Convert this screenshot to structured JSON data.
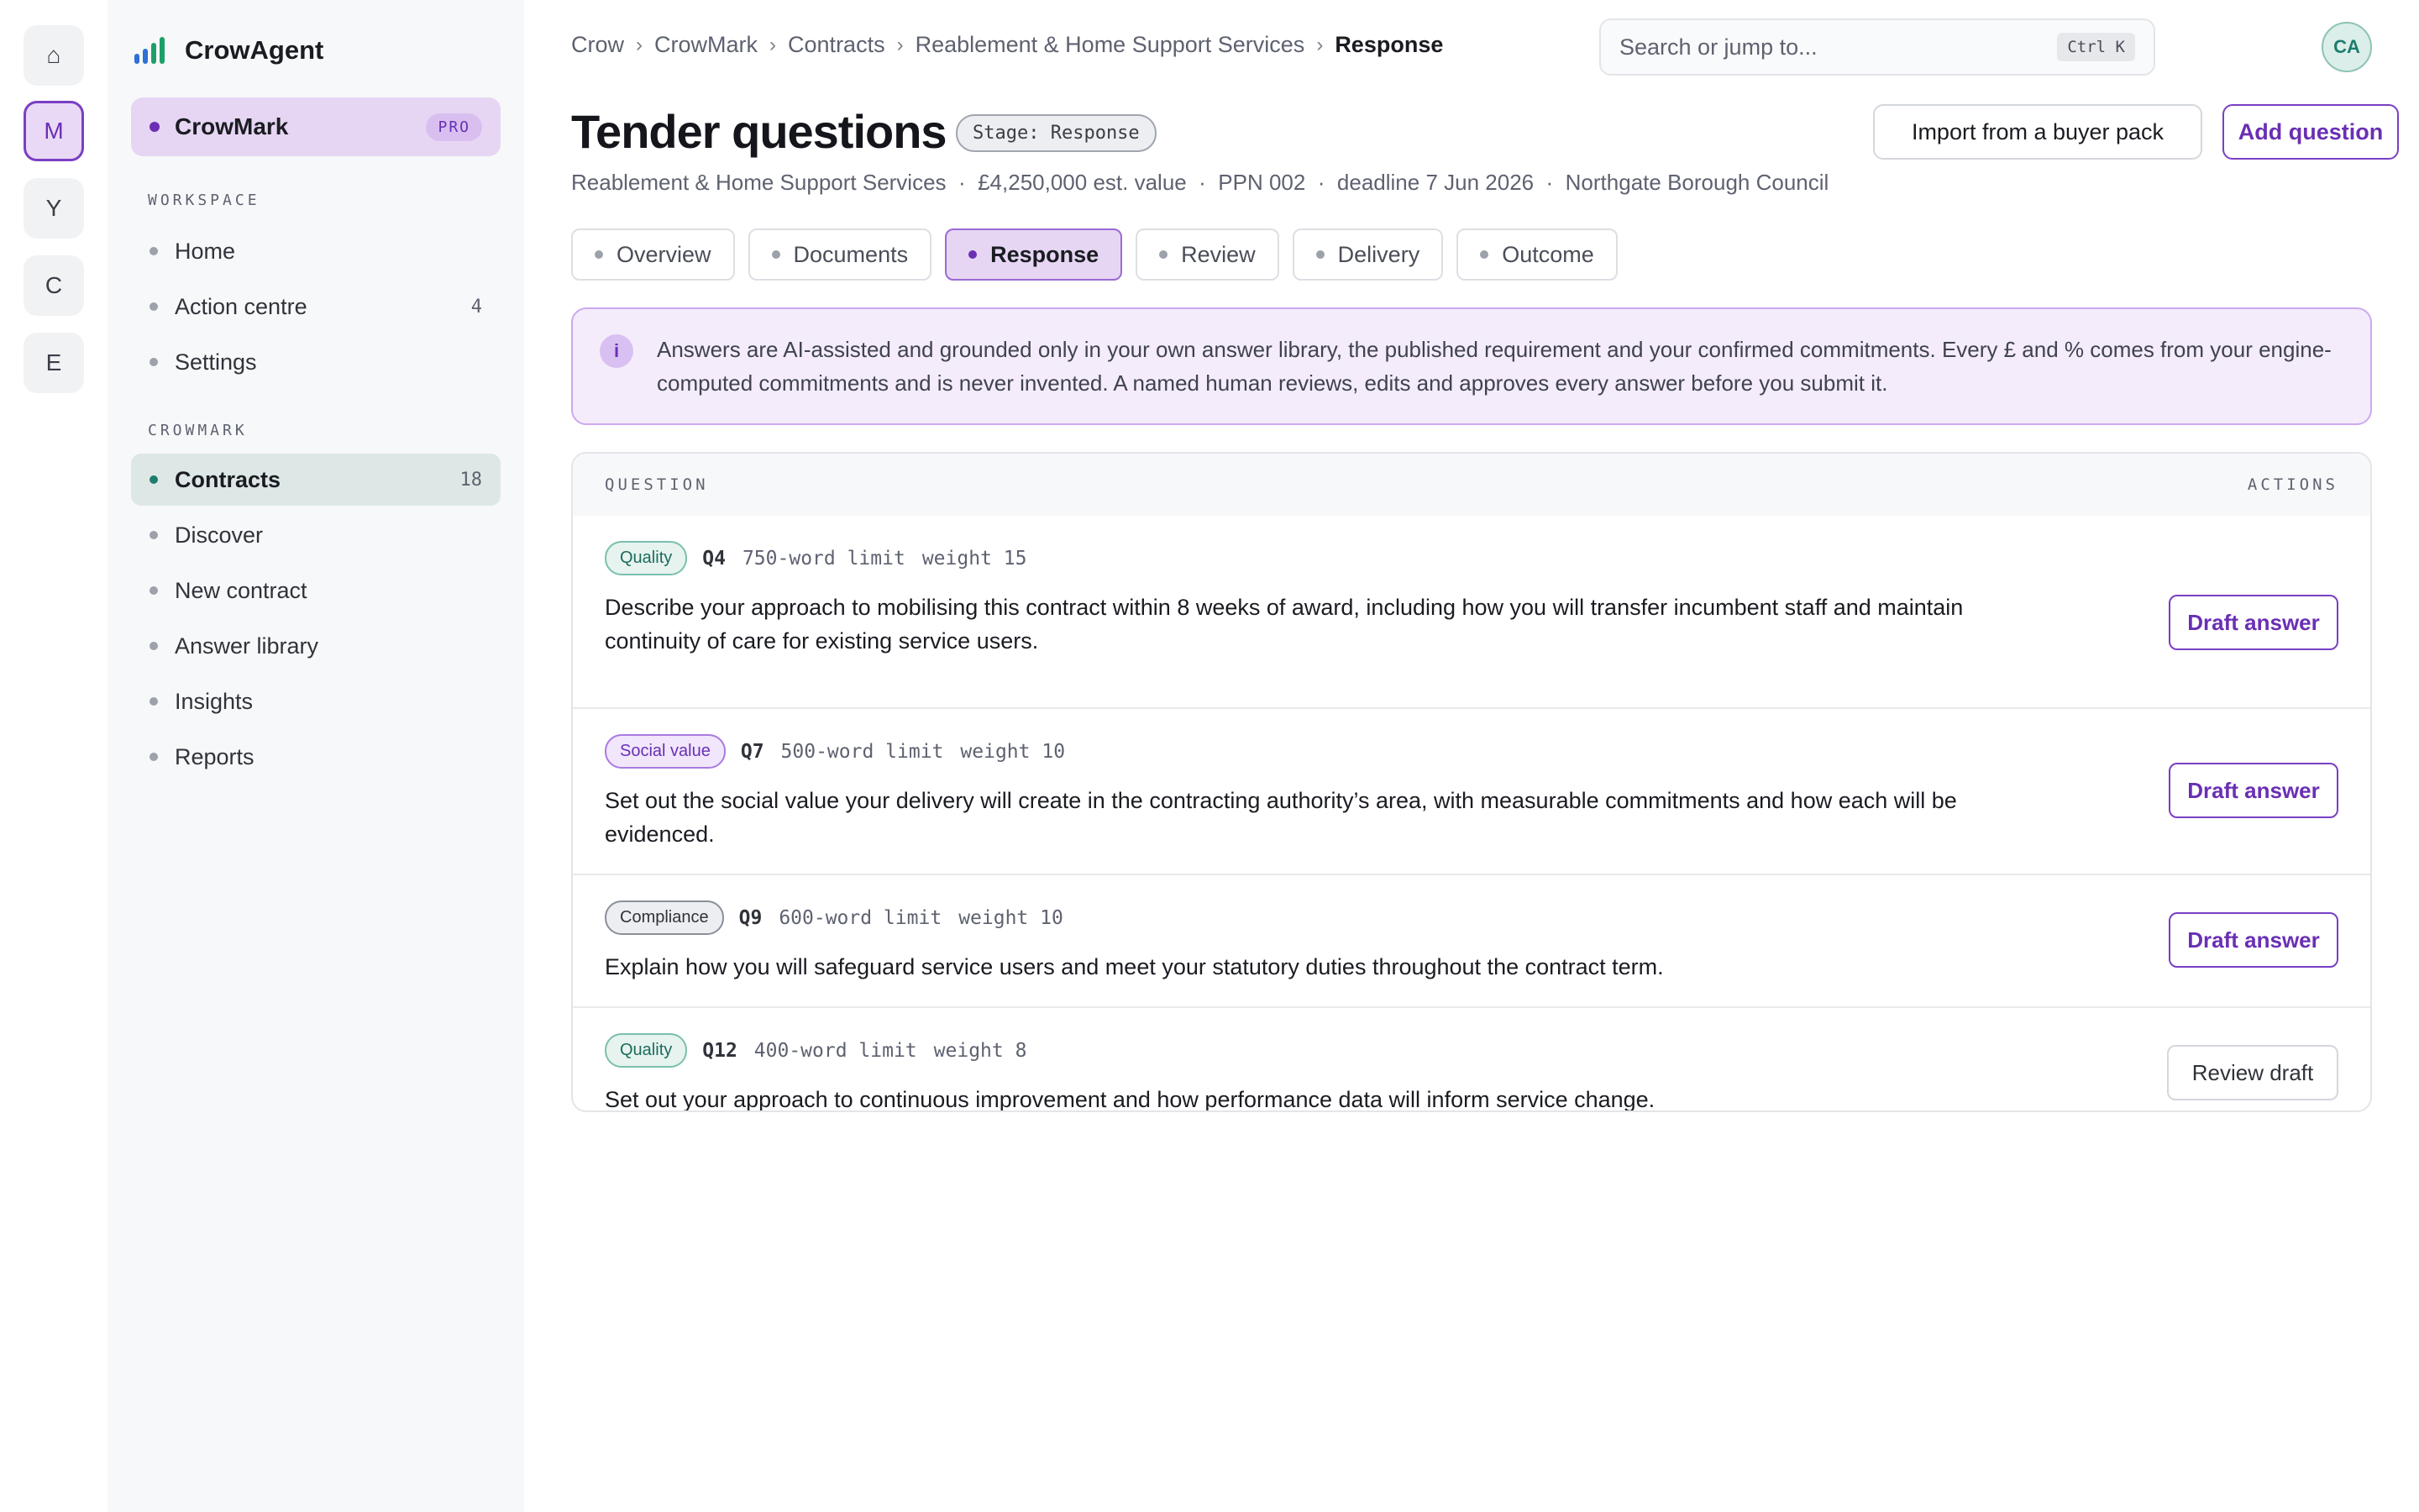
{
  "rail": {
    "items": [
      {
        "label": "⌂",
        "icon": "home-icon"
      },
      {
        "label": "M"
      },
      {
        "label": "Y"
      },
      {
        "label": "C"
      },
      {
        "label": "E"
      }
    ]
  },
  "sidebar": {
    "brand": "CrowAgent",
    "org": {
      "name": "CrowMark",
      "badge": "PRO"
    },
    "sections": [
      {
        "label": "WORKSPACE",
        "items": [
          {
            "label": "Home",
            "count": ""
          },
          {
            "label": "Action centre",
            "count": "4"
          },
          {
            "label": "Settings",
            "count": ""
          }
        ]
      },
      {
        "label": "CROWMARK",
        "items": [
          {
            "label": "Contracts",
            "count": "18"
          },
          {
            "label": "Discover",
            "count": ""
          },
          {
            "label": "New contract",
            "count": ""
          },
          {
            "label": "Answer library",
            "count": ""
          },
          {
            "label": "Insights",
            "count": ""
          },
          {
            "label": "Reports",
            "count": ""
          }
        ]
      }
    ]
  },
  "header": {
    "breadcrumb": [
      "Crow",
      "CrowMark",
      "Contracts",
      "Reablement & Home Support Services",
      "Response"
    ],
    "breadcrumb_sep": "›",
    "search_placeholder": "Search or jump to...",
    "search_shortcut": "Ctrl K",
    "avatar": "CA"
  },
  "page": {
    "title": "Tender questions",
    "stage": "Stage: Response",
    "meta": "Reablement & Home Support Services  ·  £4,250,000 est. value  ·  PPN 002  ·  deadline 7 Jun 2026  ·  Northgate Borough Council",
    "import_button": "Import from a buyer pack",
    "add_button": "Add question"
  },
  "tabs": [
    {
      "label": "Overview"
    },
    {
      "label": "Documents"
    },
    {
      "label": "Response"
    },
    {
      "label": "Review"
    },
    {
      "label": "Delivery"
    },
    {
      "label": "Outcome"
    }
  ],
  "notice": {
    "icon": "i",
    "text": "Answers are AI-assisted and grounded only in your own answer library, the published requirement and your confirmed commitments. Every £ and % comes from your engine-computed commitments and is never invented. A named human reviews, edits and approves every answer before you submit it."
  },
  "questions": {
    "header_question": "QUESTION",
    "header_actions": "ACTIONS",
    "rows": [
      {
        "tag": "Quality",
        "num": "Q4",
        "limit": "750-word limit",
        "weight": "weight 15",
        "text": "Describe your approach to mobilising this contract within 8 weeks of award, including how you will transfer incumbent staff and maintain continuity of care for existing service users.",
        "action": "Draft answer"
      },
      {
        "tag": "Social value",
        "num": "Q7",
        "limit": "500-word limit",
        "weight": "weight 10",
        "text": "Set out the social value your delivery will create in the contracting authority’s area, with measurable commitments and how each will be evidenced.",
        "action": "Draft answer"
      },
      {
        "tag": "Compliance",
        "num": "Q9",
        "limit": "600-word limit",
        "weight": "weight 10",
        "text": "Explain how you will safeguard service users and meet your statutory duties throughout the contract term.",
        "action": "Draft answer"
      },
      {
        "tag": "Quality",
        "num": "Q12",
        "limit": "400-word limit",
        "weight": "weight 8",
        "text": "Set out your approach to continuous improvement and how performance data will inform service change.",
        "action": "Review draft"
      }
    ]
  }
}
